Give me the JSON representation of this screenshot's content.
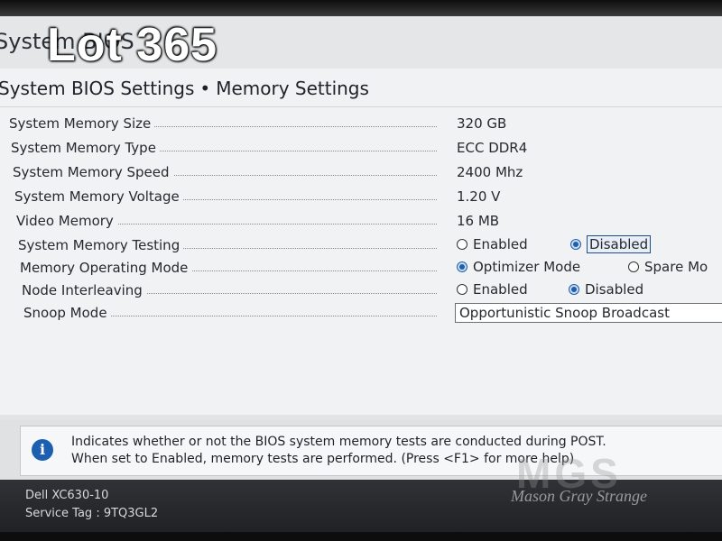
{
  "header": {
    "title": "System BIOS",
    "overlay": "Lot 365"
  },
  "breadcrumb": {
    "parent": "System BIOS Settings",
    "separator": "•",
    "current": "Memory Settings"
  },
  "settings": [
    {
      "label": "System Memory Size",
      "value": "320 GB"
    },
    {
      "label": "System Memory Type",
      "value": "ECC DDR4"
    },
    {
      "label": "System Memory Speed",
      "value": "2400 Mhz"
    },
    {
      "label": "System Memory Voltage",
      "value": "1.20 V"
    },
    {
      "label": "Video Memory",
      "value": "16 MB"
    },
    {
      "label": "System Memory Testing",
      "options": [
        "Enabled",
        "Disabled"
      ],
      "selected": "Disabled"
    },
    {
      "label": "Memory Operating Mode",
      "options": [
        "Optimizer Mode",
        "Spare Mo"
      ],
      "selected": "Optimizer Mode"
    },
    {
      "label": "Node Interleaving",
      "options": [
        "Enabled",
        "Disabled"
      ],
      "selected": "Disabled"
    },
    {
      "label": "Snoop Mode",
      "value": "Opportunistic Snoop Broadcast"
    }
  ],
  "help": {
    "line1": "Indicates whether or not the BIOS system memory tests are conducted during POST.",
    "line2": "When set to Enabled, memory tests are performed. (Press <F1> for more help)",
    "icon": "info-icon"
  },
  "footer": {
    "model": "Dell XC630-10",
    "service_tag": "Service Tag : 9TQ3GL2"
  },
  "watermark": {
    "text": "Mason Gray Strange",
    "logo": "MGS"
  },
  "colors": {
    "accent": "#1f5ea8",
    "info_icon": "#1c5fb0",
    "panel_bg": "#f1f2f3",
    "footer_bg": "#2a2c2f"
  }
}
